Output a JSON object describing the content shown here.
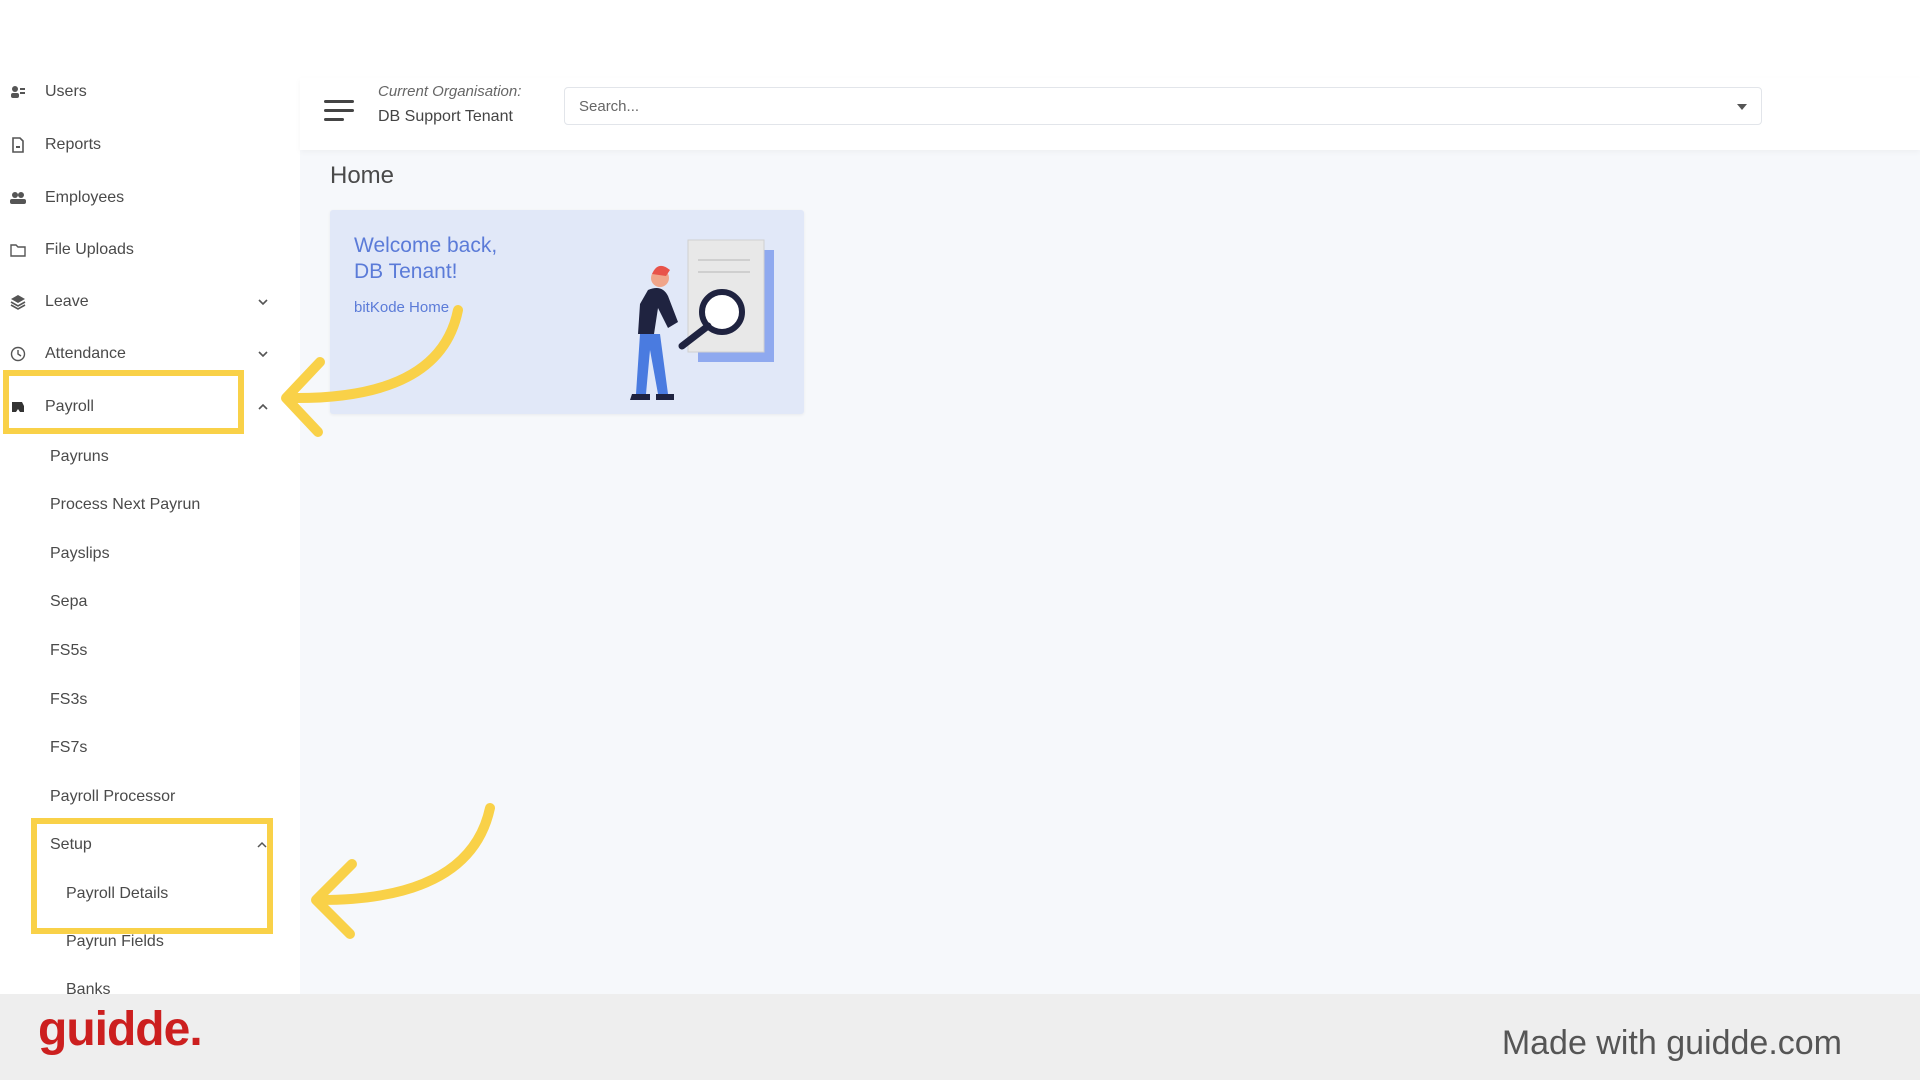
{
  "sidebar": {
    "items": [
      {
        "label": "Users",
        "icon": "users-icon"
      },
      {
        "label": "Reports",
        "icon": "report-icon"
      },
      {
        "label": "Employees",
        "icon": "employees-icon"
      },
      {
        "label": "File Uploads",
        "icon": "folder-icon"
      },
      {
        "label": "Leave",
        "icon": "layers-icon"
      },
      {
        "label": "Attendance",
        "icon": "clock-icon"
      },
      {
        "label": "Payroll",
        "icon": "payroll-icon"
      }
    ],
    "payroll_children": [
      "Payruns",
      "Process Next Payrun",
      "Payslips",
      "Sepa",
      "FS5s",
      "FS3s",
      "FS7s",
      "Payroll Processor",
      "Setup"
    ],
    "setup_children": [
      "Payroll Details",
      "Payrun Fields",
      "Banks"
    ]
  },
  "header": {
    "org_label": "Current Organisation:",
    "org_name": "DB Support Tenant",
    "search_placeholder": "Search..."
  },
  "page": {
    "title": "Home",
    "welcome_line1": "Welcome back,",
    "welcome_line2": "DB Tenant!",
    "link": "bitKode Home"
  },
  "footer": {
    "logo": "guidde.",
    "made_with": "Made with guidde.com"
  },
  "colors": {
    "highlight": "#f9d148",
    "accent": "#5b7bd8",
    "brand": "#cc1f1f"
  }
}
